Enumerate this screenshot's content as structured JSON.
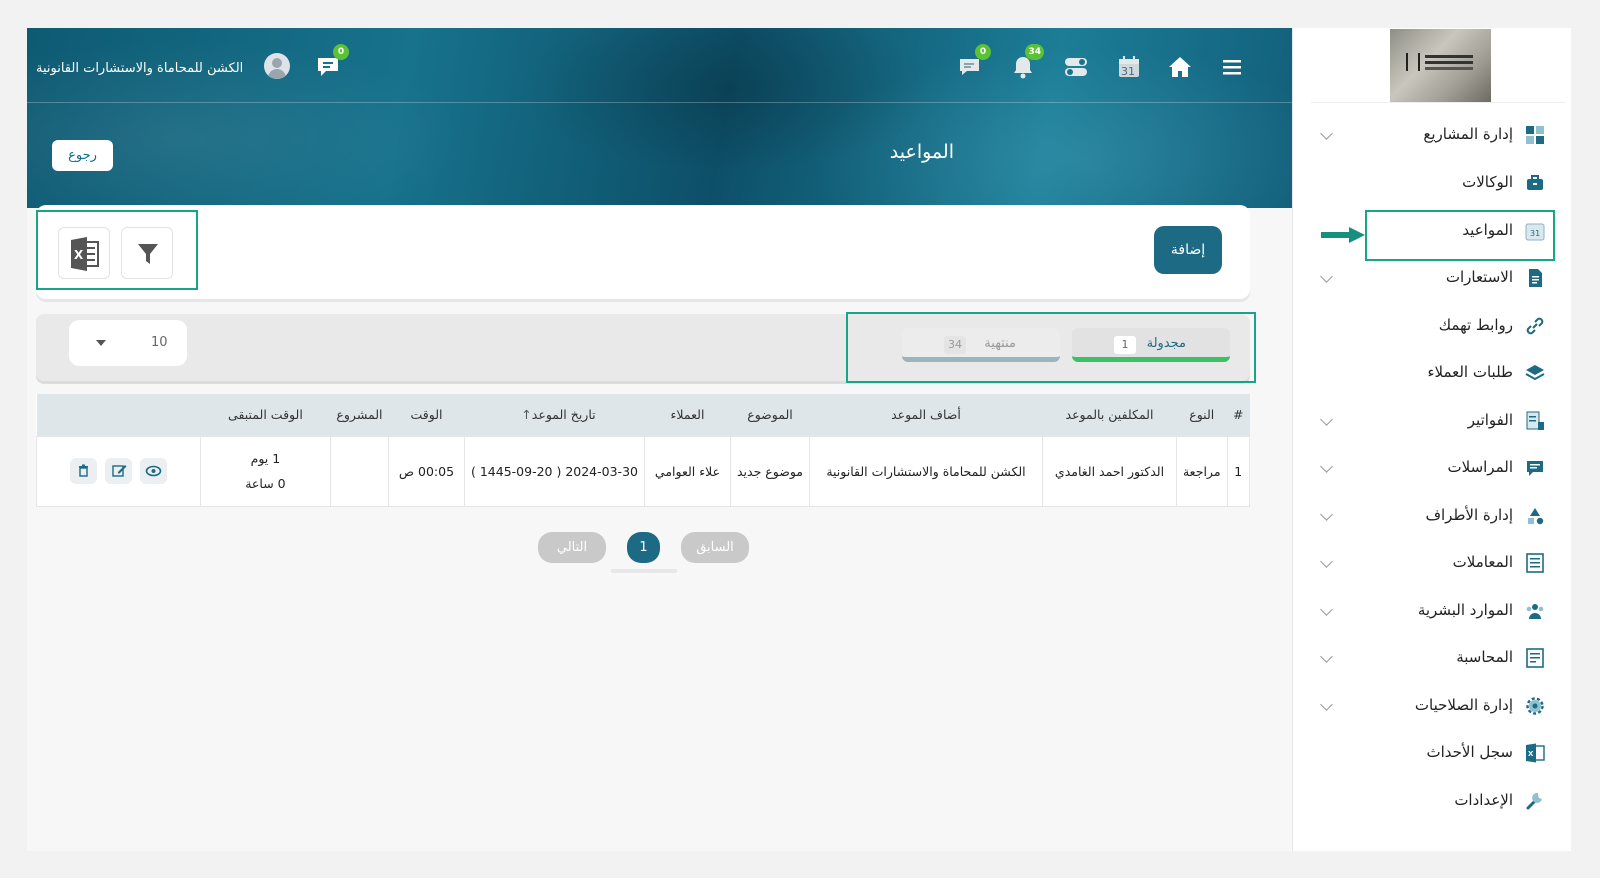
{
  "header": {
    "org_name": "الكشن للمحاماة والاستشارات القانونية",
    "chat_badge": "0",
    "messages_badge": "0",
    "notifications_badge": "34",
    "calendar_day": "31",
    "page_title": "المواعيد",
    "back_label": "رجوع"
  },
  "toolbar": {
    "add_label": "إضافة",
    "export_icon": "excel-icon",
    "filter_icon": "filter-icon"
  },
  "tabs": [
    {
      "label": "مجدولة",
      "count": "1"
    },
    {
      "label": "منتهية",
      "count": "34"
    }
  ],
  "page_size": "10",
  "table": {
    "columns": {
      "index": "#",
      "type": "النوع",
      "assignees": "المكلفين بالموعد",
      "added_by": "أضاف الموعد",
      "subject": "الموضوع",
      "clients": "العملاء",
      "date": "تاريخ الموعد",
      "time": "الوقت",
      "project": "المشروع",
      "remaining": "الوقت المتبقى"
    },
    "rows": [
      {
        "index": "1",
        "type": "مراجعة",
        "assignees": "الدكتور احمد الغامدي",
        "added_by": "الكشن للمحاماة والاستشارات القانونية",
        "subject": "موضوع جديد",
        "clients": "علاء العوامي",
        "date": "2024-03-30 ( 1445-09-20 )",
        "time": "00:05 ص",
        "project": "",
        "remaining_days": "1 يوم",
        "remaining_hours": "0 ساعة"
      }
    ]
  },
  "pagination": {
    "next_label": "التالي",
    "current_page": "1",
    "prev_label": "السابق"
  },
  "sidebar": {
    "items": [
      {
        "label": "إدارة المشاريع",
        "icon": "dashboard-icon",
        "has_children": true
      },
      {
        "label": "الوكالات",
        "icon": "briefcase-icon",
        "has_children": false
      },
      {
        "label": "المواعيد",
        "icon": "calendar-icon",
        "has_children": false,
        "active": true
      },
      {
        "label": "الاستعارات",
        "icon": "document-icon",
        "has_children": true
      },
      {
        "label": "روابط تهمك",
        "icon": "link-icon",
        "has_children": false
      },
      {
        "label": "طلبات العملاء",
        "icon": "layers-icon",
        "has_children": false
      },
      {
        "label": "الفواتير",
        "icon": "invoice-icon",
        "has_children": true
      },
      {
        "label": "المراسلات",
        "icon": "message-icon",
        "has_children": true
      },
      {
        "label": "إدارة الأطراف",
        "icon": "shapes-icon",
        "has_children": true
      },
      {
        "label": "المعاملات",
        "icon": "list-icon",
        "has_children": true
      },
      {
        "label": "الموارد البشرية",
        "icon": "users-icon",
        "has_children": true
      },
      {
        "label": "المحاسبة",
        "icon": "ledger-icon",
        "has_children": true
      },
      {
        "label": "إدارة الصلاحيات",
        "icon": "gear-icon",
        "has_children": true
      },
      {
        "label": "سجل الأحداث",
        "icon": "excel-icon",
        "has_children": false
      },
      {
        "label": "الإعدادات",
        "icon": "wrench-icon",
        "has_children": false
      }
    ]
  },
  "colors": {
    "primary": "#1d6a84",
    "highlight_box": "#17a58a",
    "badge": "#5bc236",
    "active_tab_underline": "#3cc065"
  }
}
